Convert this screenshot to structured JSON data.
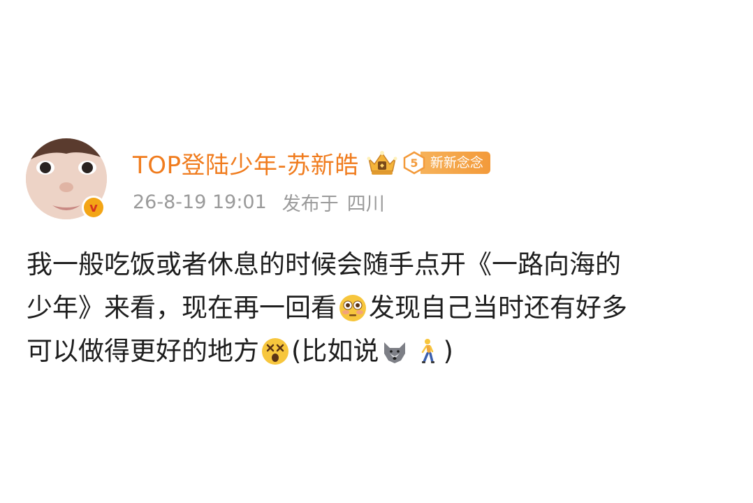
{
  "post": {
    "author": {
      "name": "TOP登陆少年-苏新皓",
      "verified_icon": "verified-v-badge",
      "crown_icon": "crown-membership-icon",
      "fan_badge": {
        "level": "5",
        "label": "新新念念"
      }
    },
    "meta": {
      "timestamp": "26-8-19 19:01",
      "location_prefix": "发布于",
      "location": "四川"
    },
    "content": {
      "line1": "我一般吃饭或者休息的时候会随手点开《一路向海的",
      "line2_a": "少年》来看，现在再一回看",
      "line2_b": "发现自己当时还有好多",
      "line3_a": "可以做得更好的地方",
      "line3_b": "(比如说",
      "line3_c": ")",
      "emojis": [
        "flushed-face-emoji",
        "dizzy-face-emoji",
        "wolf-emoji",
        "walking-person-emoji"
      ]
    }
  },
  "colors": {
    "username": "#f07c1e",
    "meta": "#9a9a9a",
    "body_text": "#1e1e1e",
    "fan_badge": "#f39a3a",
    "verified": "#f3a516"
  }
}
